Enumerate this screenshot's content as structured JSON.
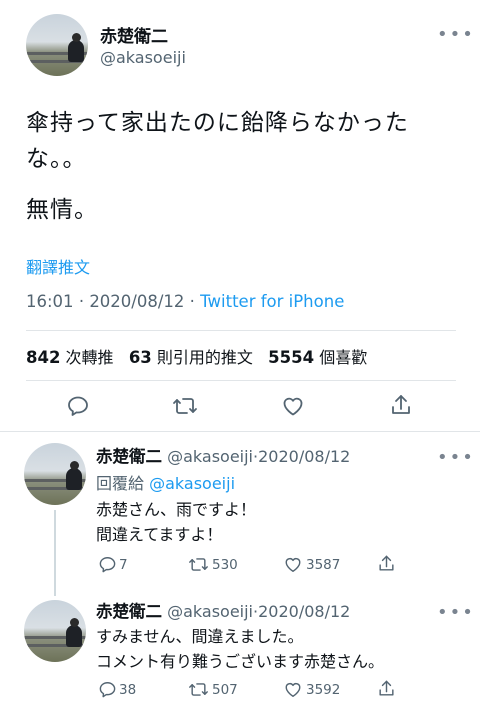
{
  "main_tweet": {
    "author_name": "赤楚衛二",
    "author_handle": "@akasoeiji",
    "more_icon": "more-dots-icon",
    "text_line1": "傘持って家出たのに飴降らなかった",
    "text_line2": "な。。",
    "text_line3": "無情。",
    "translate_label": "翻譯推文",
    "time": "16:01",
    "date": "2020/08/12",
    "source": "Twitter for iPhone",
    "retweets_count": "842",
    "retweets_label": "次轉推",
    "quotes_count": "63",
    "quotes_label": "則引用的推文",
    "likes_count": "5554",
    "likes_label": "個喜歡"
  },
  "replies": [
    {
      "author_name": "赤楚衛二",
      "author_handle": "@akasoeiji",
      "date": "2020/08/12",
      "replying_to_label": "回覆給",
      "replying_to_handle": "@akasoeiji",
      "text_line1": "赤楚さん、雨ですよ！",
      "text_line2": "間違えてますよ！",
      "reply_count": "7",
      "retweet_count": "530",
      "like_count": "3587"
    },
    {
      "author_name": "赤楚衛二",
      "author_handle": "@akasoeiji",
      "date": "2020/08/12",
      "text_line1": "すみません、間違えました。",
      "text_line2": "コメント有り難うございます赤楚さん。",
      "reply_count": "38",
      "retweet_count": "507",
      "like_count": "3592"
    }
  ],
  "separator": "·",
  "colors": {
    "link": "#1d9bf0",
    "secondary": "#536471",
    "text": "#0f1419"
  }
}
